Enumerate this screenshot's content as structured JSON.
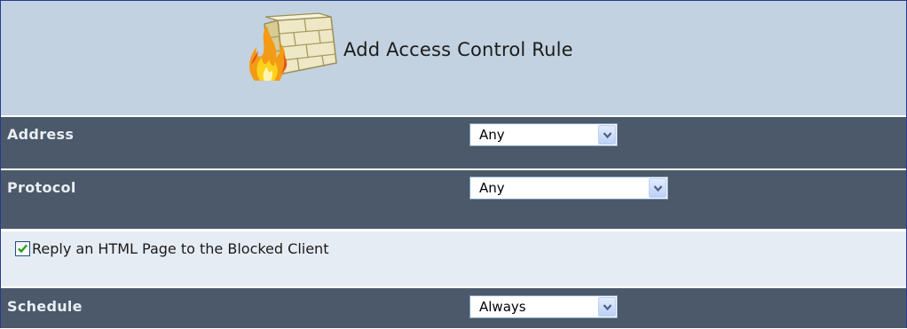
{
  "header": {
    "title": "Add Access Control Rule",
    "icon": "firewall-icon"
  },
  "rows": {
    "address": {
      "label": "Address",
      "selected": "Any"
    },
    "protocol": {
      "label": "Protocol",
      "selected": "Any"
    },
    "reply_html": {
      "label": "Reply an HTML Page to the Blocked Client",
      "checked": true
    },
    "schedule": {
      "label": "Schedule",
      "selected": "Always"
    }
  },
  "colors": {
    "header_bg": "#c3d2e0",
    "dark_row": "#4b596a",
    "light_row": "#e6ecf4",
    "check_green": "#21a121"
  }
}
